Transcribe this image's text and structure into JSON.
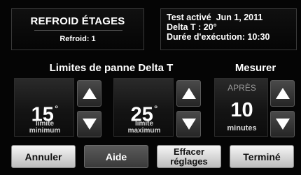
{
  "header": {
    "title": "REFROID ÉTAGES",
    "subtitle": "Refroid: 1",
    "test_line": "Test activé  Jun 1, 2011",
    "delta_line": "Delta T : 20°",
    "duration_line": "Durée d'exécution: 10:30"
  },
  "sections": {
    "limits_title": "Limites de panne Delta T",
    "measure_title": "Mesurer"
  },
  "min_limit": {
    "value": "15",
    "unit": "°",
    "caption1": "limite",
    "caption2": "minimum"
  },
  "max_limit": {
    "value": "25",
    "unit": "°",
    "caption1": "limite",
    "caption2": "maximum"
  },
  "measure": {
    "prefix": "APRÈS",
    "value": "10",
    "unit": "minutes"
  },
  "buttons": {
    "cancel": "Annuler",
    "help": "Aide",
    "reset_line1": "Effacer",
    "reset_line2": "réglages",
    "done": "Terminé"
  },
  "icons": {
    "up": "up-arrow-icon",
    "down": "down-arrow-icon"
  }
}
